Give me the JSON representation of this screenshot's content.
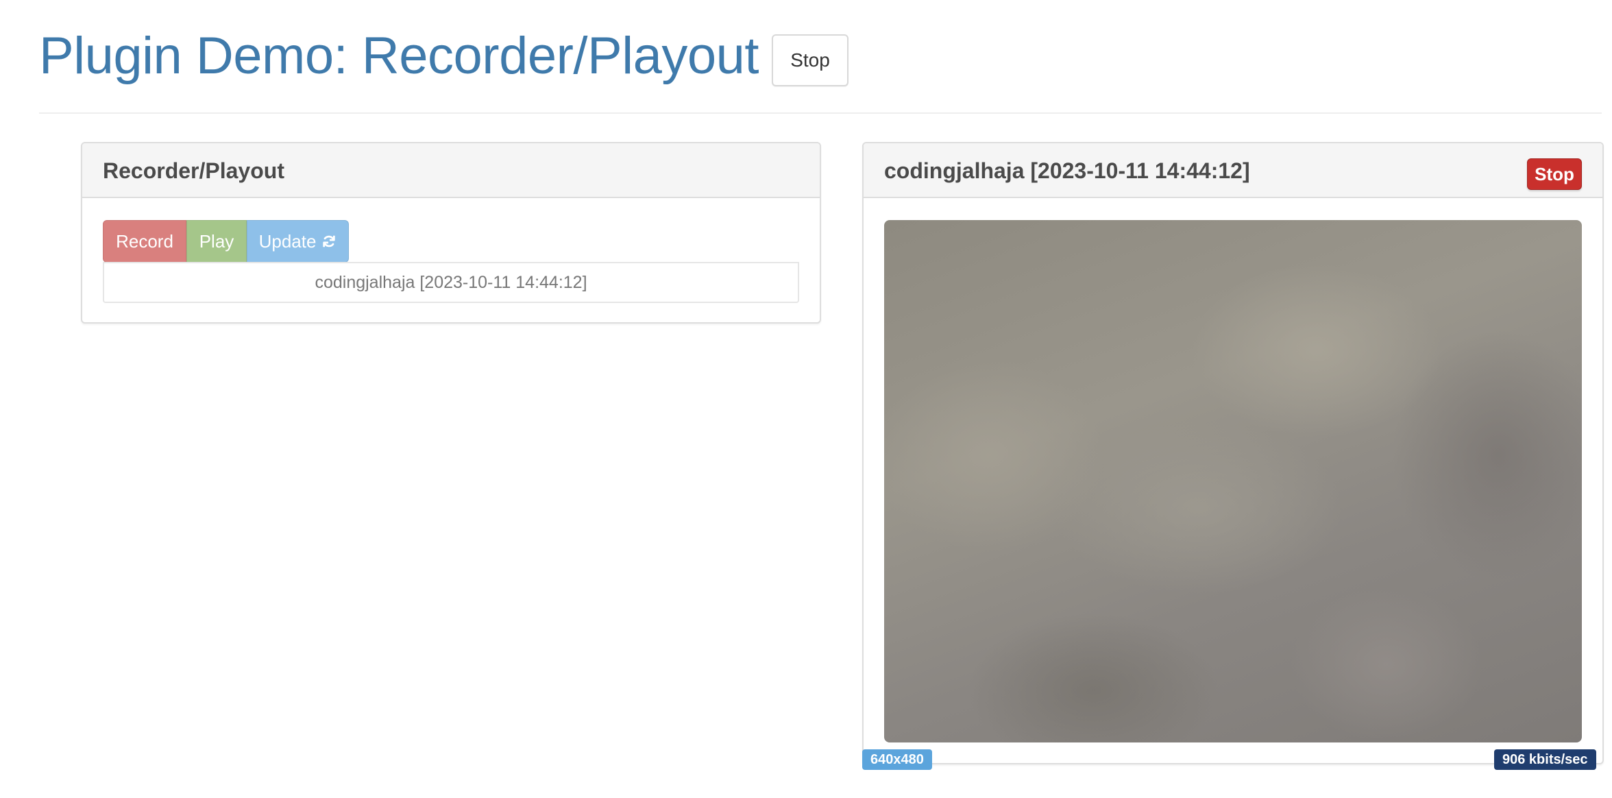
{
  "header": {
    "title": "Plugin Demo: Recorder/Playout",
    "stop_label": "Stop"
  },
  "recorder_panel": {
    "title": "Recorder/Playout",
    "buttons": {
      "record": "Record",
      "play": "Play",
      "update": "Update"
    },
    "selected_recording": "codingjalhaja [2023-10-11 14:44:12]"
  },
  "video_panel": {
    "title": "codingjalhaja [2023-10-11 14:44:12]",
    "stop_label": "Stop",
    "resolution": "640x480",
    "bitrate": "906 kbits/sec"
  },
  "colors": {
    "title": "#3f7aab",
    "record": "#d9807e",
    "play": "#a5c68a",
    "update": "#8ec0e9",
    "stop_danger": "#c9302c",
    "badge_resolution": "#5ba4dc",
    "badge_bitrate": "#1f3d6e"
  },
  "icons": {
    "update": "refresh-icon"
  }
}
